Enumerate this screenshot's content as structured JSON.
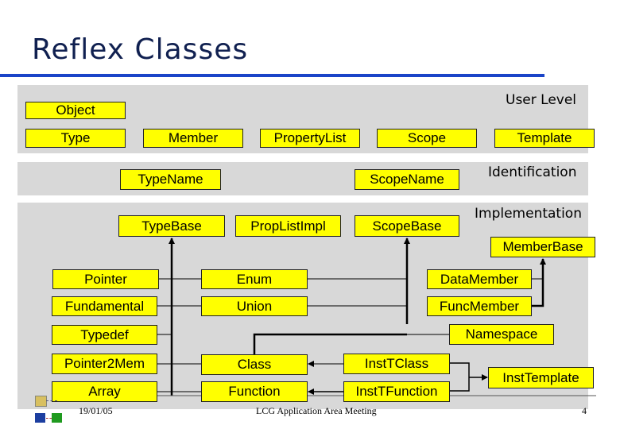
{
  "title": "Reflex Classes",
  "bands": {
    "user_level": "User Level",
    "identification": "Identification",
    "implementation": "Implementation"
  },
  "boxes": {
    "object": "Object",
    "type": "Type",
    "member": "Member",
    "property_list": "PropertyList",
    "scope": "Scope",
    "template": "Template",
    "type_name": "TypeName",
    "scope_name": "ScopeName",
    "type_base": "TypeBase",
    "prop_list_impl": "PropListImpl",
    "scope_base": "ScopeBase",
    "member_base": "MemberBase",
    "pointer": "Pointer",
    "enum": "Enum",
    "data_member": "DataMember",
    "fundamental": "Fundamental",
    "union": "Union",
    "func_member": "FuncMember",
    "typedef": "Typedef",
    "namespace": "Namespace",
    "pointer2mem": "Pointer2Mem",
    "class": "Class",
    "inst_t_class": "InstTClass",
    "inst_template": "InstTemplate",
    "array": "Array",
    "function": "Function",
    "inst_t_function": "InstTFunction"
  },
  "footer": {
    "date": "19/01/05",
    "meeting": "LCG Application Area Meeting",
    "page": "4"
  },
  "colors": {
    "box_fill": "#ffff00",
    "band_fill": "#d8d8d8",
    "title_color": "#102050",
    "rule_color": "#1a44c8"
  }
}
